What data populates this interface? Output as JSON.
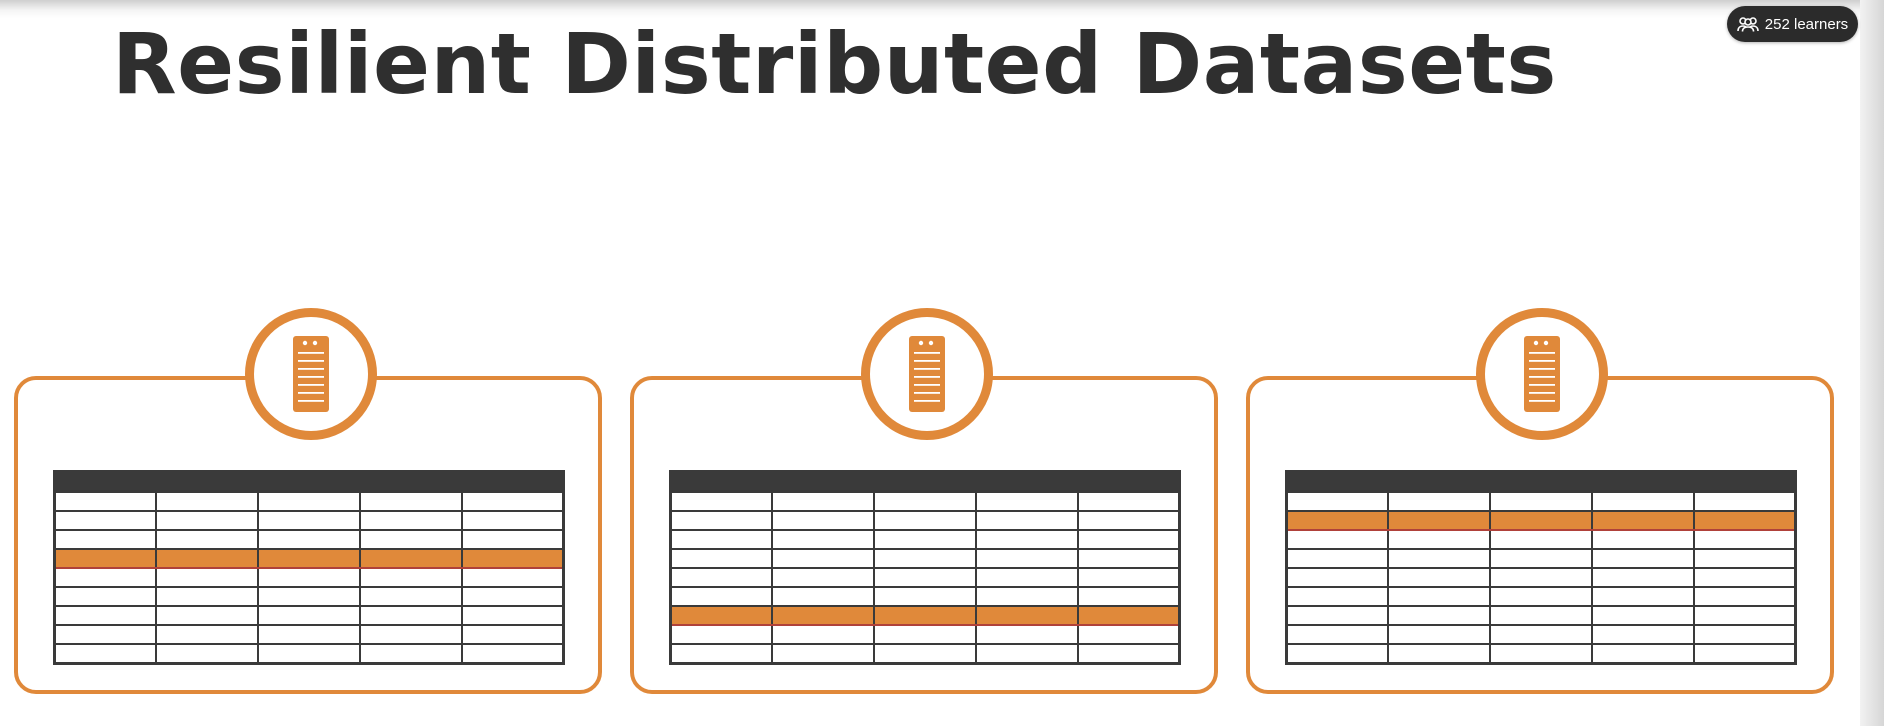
{
  "slide": {
    "title": "Resilient Distributed Datasets"
  },
  "badge": {
    "label": "252 learners",
    "icon": "users-icon",
    "color": "#2b2b2b"
  },
  "colors": {
    "accent": "#e0893a",
    "table_border": "#3a3a3a",
    "title": "#2f2f2f"
  },
  "nodes": [
    {
      "icon": "server-icon",
      "columns": 5,
      "rows": 9,
      "highlighted_row": 4
    },
    {
      "icon": "server-icon",
      "columns": 5,
      "rows": 9,
      "highlighted_row": 7
    },
    {
      "icon": "server-icon",
      "columns": 5,
      "rows": 9,
      "highlighted_row": 2
    }
  ]
}
